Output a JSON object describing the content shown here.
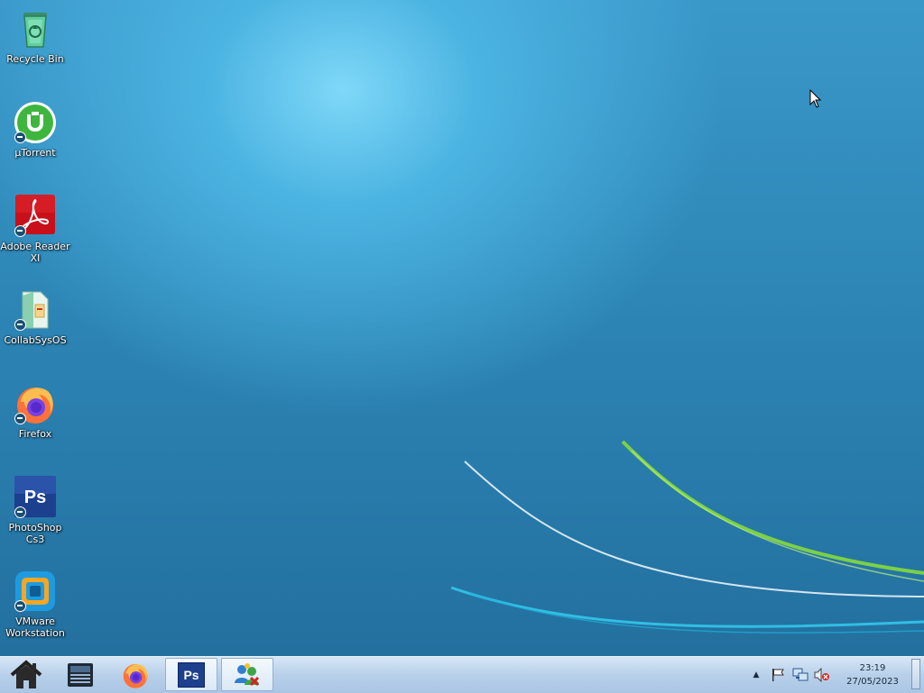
{
  "desktop": {
    "icons": [
      {
        "label": "Recycle Bin",
        "icon": "recycle-bin-icon"
      },
      {
        "label": "µTorrent",
        "icon": "utorrent-icon"
      },
      {
        "label": "Adobe Reader XI",
        "icon": "adobe-reader-icon"
      },
      {
        "label": "CollabSysOS",
        "icon": "collabsysos-icon"
      },
      {
        "label": "Firefox",
        "icon": "firefox-icon"
      },
      {
        "label": "PhotoShop Cs3",
        "icon": "photoshop-icon"
      },
      {
        "label": "VMware Workstation",
        "icon": "vmware-icon"
      }
    ]
  },
  "taskbar": {
    "buttons": [
      {
        "name": "home",
        "icon": "home-icon"
      },
      {
        "name": "file-manager",
        "icon": "file-manager-icon"
      },
      {
        "name": "firefox",
        "icon": "firefox-icon"
      },
      {
        "name": "photoshop",
        "icon": "photoshop-icon",
        "active": true,
        "glyph": "Ps"
      },
      {
        "name": "network-people",
        "icon": "people-network-icon"
      }
    ],
    "tray": {
      "icons": [
        "show-hidden-icons-icon",
        "flag-icon",
        "network-icon",
        "volume-muted-icon"
      ]
    },
    "clock": {
      "time": "23:19",
      "date": "27/05/2023"
    }
  },
  "colors": {
    "desktop_light": "#7fd8f8",
    "desktop_dark": "#23709f",
    "taskbar": "#b8d0ea"
  }
}
